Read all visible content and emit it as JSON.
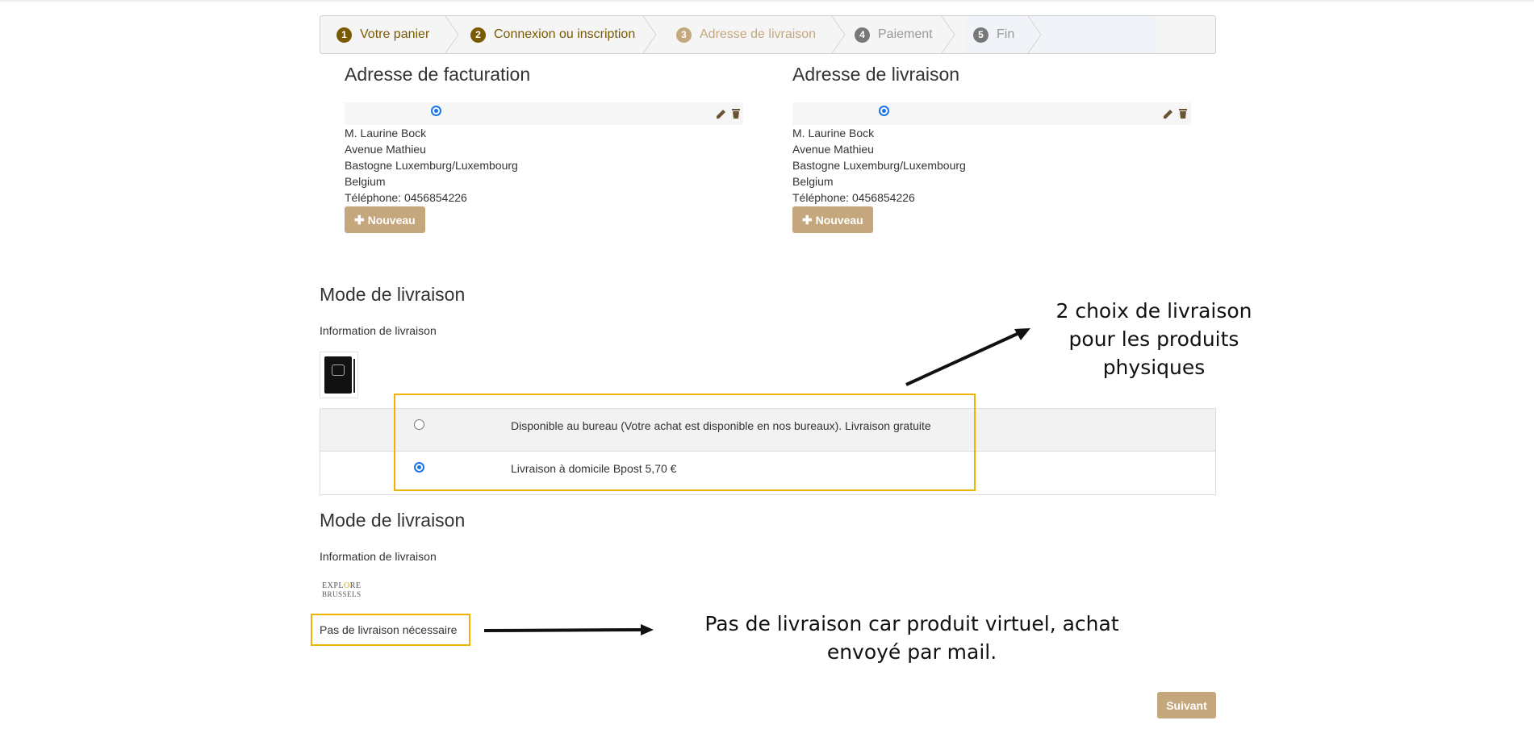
{
  "stepper": {
    "steps": [
      {
        "num": "1",
        "label": "Votre panier",
        "state": "done"
      },
      {
        "num": "2",
        "label": "Connexion ou inscription",
        "state": "done"
      },
      {
        "num": "3",
        "label": "Adresse de livraison",
        "state": "current"
      },
      {
        "num": "4",
        "label": "Paiement",
        "state": "future"
      },
      {
        "num": "5",
        "label": "Fin",
        "state": "future"
      }
    ]
  },
  "billing": {
    "title": "Adresse de facturation",
    "lines": [
      "M. Laurine Bock",
      "Avenue Mathieu",
      "Bastogne Luxemburg/Luxembourg",
      "Belgium",
      "Téléphone: 0456854226"
    ],
    "new_button": "Nouveau"
  },
  "shipping_address": {
    "title": "Adresse de livraison",
    "lines": [
      "M. Laurine Bock",
      "Avenue Mathieu",
      "Bastogne Luxemburg/Luxembourg",
      "Belgium",
      "Téléphone: 0456854226"
    ],
    "new_button": "Nouveau"
  },
  "delivery_physical": {
    "title": "Mode de livraison",
    "info_label": "Information de livraison",
    "options": [
      {
        "label": "Disponible au bureau (Votre achat est disponible en nos bureaux). Livraison gratuite",
        "selected": false
      },
      {
        "label": "Livraison à domicile Bpost 5,70 €",
        "selected": true
      }
    ]
  },
  "delivery_virtual": {
    "title": "Mode de livraison",
    "info_label": "Information de livraison",
    "logo_line1": "EXPL",
    "logo_accent": "O",
    "logo_line1b": "RE",
    "logo_line2": "BRUSSELS",
    "no_delivery": "Pas de livraison nécessaire"
  },
  "annotations": {
    "physical_line1": "2 choix de livraison",
    "physical_line2": "pour les produits",
    "physical_line3": "physiques",
    "virtual_line1": "Pas de livraison car produit virtuel, achat",
    "virtual_line2": "envoyé par mail."
  },
  "next_button": "Suivant",
  "colors": {
    "accent": "#c4a77d",
    "step_done": "#7a5a00",
    "highlight": "#f0b400",
    "radio_selected": "#1a73e8"
  }
}
